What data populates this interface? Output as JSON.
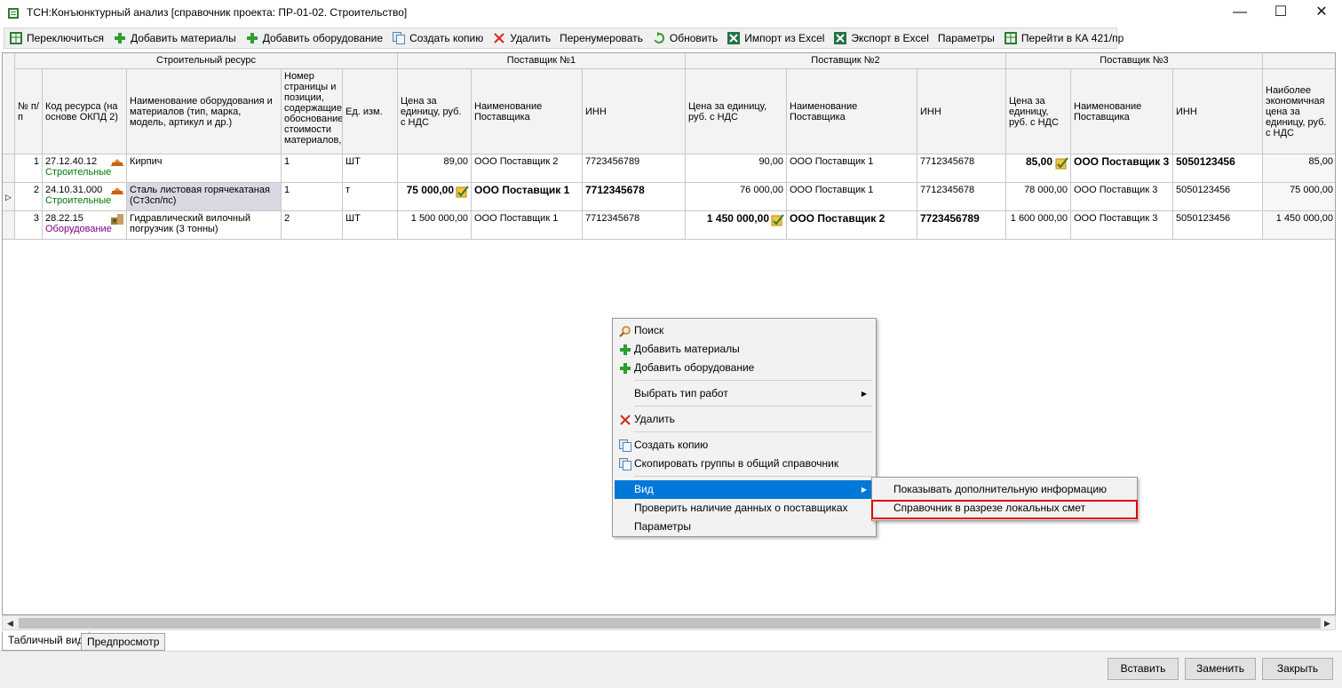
{
  "window": {
    "title": "ТСН:Конъюнктурный анализ [справочник проекта: ПР-01-02. Строительство]"
  },
  "toolbar": [
    {
      "label": "Переключиться",
      "icon": "excel-grid-icon"
    },
    {
      "label": "Добавить материалы",
      "icon": "green-plus-icon"
    },
    {
      "label": "Добавить оборудование",
      "icon": "green-plus-icon"
    },
    {
      "label": "Создать копию",
      "icon": "copy-icon"
    },
    {
      "label": "Удалить",
      "icon": "red-x-icon"
    },
    {
      "label": "Перенумеровать",
      "icon": ""
    },
    {
      "label": "Обновить",
      "icon": "refresh-icon"
    },
    {
      "label": "Импорт из Excel",
      "icon": "excel-icon"
    },
    {
      "label": "Экспорт в Excel",
      "icon": "excel-icon"
    },
    {
      "label": "Параметры",
      "icon": ""
    },
    {
      "label": "Перейти в КА 421/пр",
      "icon": "excel-grid-icon"
    }
  ],
  "grid": {
    "groups": {
      "resource": "Строительный ресурс",
      "s1": "Поставщик №1",
      "s2": "Поставщик №2",
      "s3": "Поставщик №3"
    },
    "columns": {
      "num": "№ п/п",
      "code": "Код ресурса (на основе ОКПД 2)",
      "name": "Наименование оборудования и материалов (тип, марка, модель, артикул и др.)",
      "page": "Номер страницы и позиции, содержащие обоснование стоимости материалов,",
      "unit": "Ед. изм.",
      "s1_price": "Цена за единицу, руб. с НДС",
      "s1_name": "Наименование Поставщика",
      "s1_inn": "ИНН",
      "s2_price": "Цена за единицу, руб. с НДС",
      "s2_name": "Наименование Поставщика",
      "s2_inn": "ИНН",
      "s3_price": "Цена за единицу, руб. с НДС",
      "s3_name": "Наименование Поставщика",
      "s3_inn": "ИНН",
      "best": "Наиболее экономичная цена за единицу, руб. с НДС"
    },
    "rows": [
      {
        "num": "1",
        "code": "27.12.40.12",
        "category": "Строительные",
        "name": "Кирпич",
        "page": "1",
        "unit": "ШТ",
        "s1_price": "89,00",
        "s1_name": "ООО Поставщик 2",
        "s1_inn": "7723456789",
        "s2_price": "90,00",
        "s2_name": "ООО Поставщик 1",
        "s2_inn": "7712345678",
        "s3_price": "85,00",
        "s3_name": "ООО Поставщик 3",
        "s3_inn": "5050123456",
        "best": "85,00"
      },
      {
        "num": "2",
        "code": "24.10.31.000",
        "category": "Строительные",
        "name": "Сталь листовая горячекатаная (Ст3сп/пс)",
        "page": "1",
        "unit": "т",
        "s1_price": "75 000,00",
        "s1_name": "ООО Поставщик 1",
        "s1_inn": "7712345678",
        "s2_price": "76 000,00",
        "s2_name": "ООО Поставщик 1",
        "s2_inn": "7712345678",
        "s3_price": "78 000,00",
        "s3_name": "ООО Поставщик 3",
        "s3_inn": "5050123456",
        "best": "75 000,00"
      },
      {
        "num": "3",
        "code": "28.22.15",
        "category": "Оборудование",
        "name": "Гидравлический вилочный погрузчик (3 тонны)",
        "page": "2",
        "unit": "ШТ",
        "s1_price": "1 500 000,00",
        "s1_name": "ООО Поставщик 1",
        "s1_inn": "7712345678",
        "s2_price": "1 450 000,00",
        "s2_name": "ООО Поставщик 2",
        "s2_inn": "7723456789",
        "s3_price": "1 600 000,00",
        "s3_name": "ООО Поставщик 3",
        "s3_inn": "5050123456",
        "best": "1 450 000,00"
      }
    ]
  },
  "context_menu": {
    "items": [
      {
        "label": "Поиск",
        "icon": "search-icon"
      },
      {
        "label": "Добавить материалы",
        "icon": "green-plus-icon"
      },
      {
        "label": "Добавить оборудование",
        "icon": "green-plus-icon"
      },
      {
        "label": "Выбрать тип работ",
        "icon": ""
      },
      {
        "label": "Удалить",
        "icon": "red-x-icon"
      },
      {
        "label": "Создать копию",
        "icon": "copy-icon"
      },
      {
        "label": "Скопировать группы в общий справочник",
        "icon": "copy-icon"
      },
      {
        "label": "Вид",
        "icon": ""
      },
      {
        "label": "Проверить наличие данных о поставщиках",
        "icon": ""
      },
      {
        "label": "Параметры",
        "icon": ""
      }
    ],
    "submenu": [
      {
        "label": "Показывать дополнительную информацию"
      },
      {
        "label": "Справочник в разрезе локальных смет"
      }
    ]
  },
  "tabs": {
    "table": "Табличный вид",
    "preview": "Предпросмотр"
  },
  "buttons": {
    "insert": "Вставить",
    "replace": "Заменить",
    "close": "Закрыть"
  },
  "colors": {
    "highlight": "#0078d7",
    "annotation": "#e00000",
    "category_materials": "#007a00",
    "category_equipment": "#800080"
  }
}
